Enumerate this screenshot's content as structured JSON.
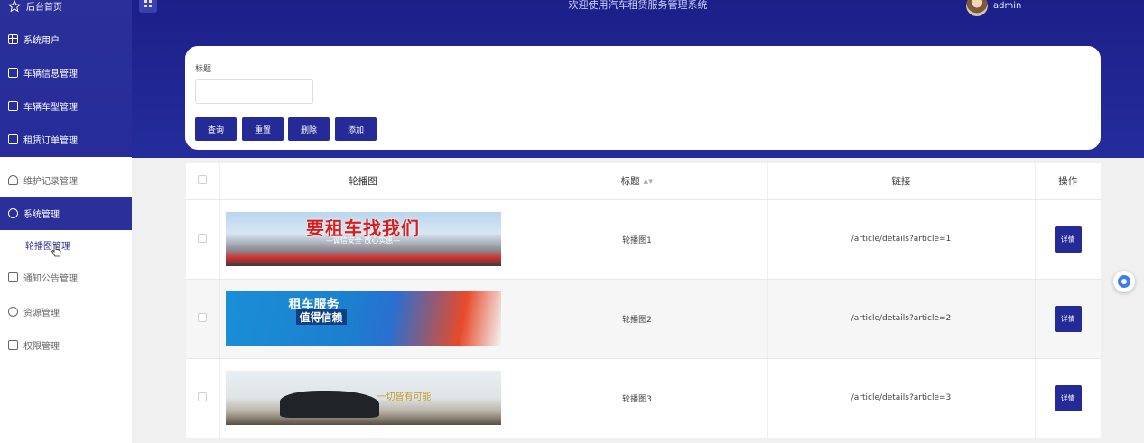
{
  "header": {
    "title": "欢迎使用汽车租赁服务管理系统",
    "username": "admin"
  },
  "sidebar": {
    "items": [
      {
        "label": "后台首页",
        "icon": "star-icon"
      },
      {
        "label": "系统用户",
        "icon": "grid-icon"
      },
      {
        "label": "车辆信息管理",
        "icon": "clipboard-icon"
      },
      {
        "label": "车辆车型管理",
        "icon": "document-icon"
      },
      {
        "label": "租赁订单管理",
        "icon": "document-icon"
      },
      {
        "label": "维护记录管理",
        "icon": "person-icon"
      },
      {
        "label": "系统管理",
        "icon": "chat-icon"
      },
      {
        "label": "通知公告管理",
        "icon": "clipboard-icon"
      },
      {
        "label": "资源管理",
        "icon": "chat-icon"
      },
      {
        "label": "权限管理",
        "icon": "document-icon"
      }
    ],
    "sub_item": "轮播图管理"
  },
  "search": {
    "label": "标题",
    "value": "",
    "buttons": {
      "query": "查询",
      "reset": "重置",
      "delete": "删除",
      "add": "添加"
    }
  },
  "table": {
    "headers": {
      "image": "轮播图",
      "title": "标题",
      "link": "链接",
      "action": "操作"
    },
    "rows": [
      {
        "title": "轮播图1",
        "link": "/article/details?article=1",
        "action": "详情",
        "banner_text": "要租车找我们",
        "banner_sub": "—诚信安全·放心实惠—"
      },
      {
        "title": "轮播图2",
        "link": "/article/details?article=2",
        "action": "详情",
        "banner_text": "租车服务",
        "banner_sub": "值得信赖"
      },
      {
        "title": "轮播图3",
        "link": "/article/details?article=3",
        "action": "详情",
        "banner_text": "一切皆有可能"
      }
    ]
  },
  "colors": {
    "primary": "#242a96",
    "sidebar_dark": "#2a2f99"
  }
}
